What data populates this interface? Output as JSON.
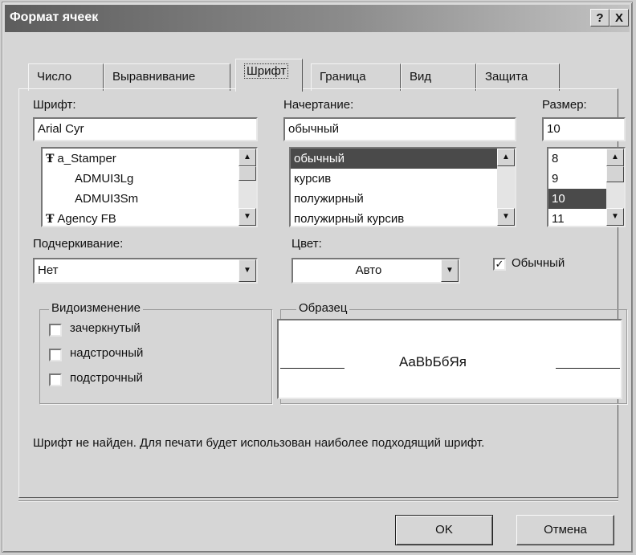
{
  "window": {
    "title": "Формат ячеек",
    "help_button": "?",
    "close_button": "X"
  },
  "tabs": [
    {
      "label": "Число",
      "active": false
    },
    {
      "label": "Выравнивание",
      "active": false
    },
    {
      "label": "Шрифт",
      "active": true
    },
    {
      "label": "Граница",
      "active": false
    },
    {
      "label": "Вид",
      "active": false
    },
    {
      "label": "Защита",
      "active": false
    }
  ],
  "font": {
    "label": "Шрифт:",
    "value": "Arial Cyr",
    "items": [
      {
        "label": "a_Stamper",
        "icon": "truetype-icon"
      },
      {
        "label": "ADMUI3Lg",
        "icon": ""
      },
      {
        "label": "ADMUI3Sm",
        "icon": ""
      },
      {
        "label": "Agency FB",
        "icon": "truetype-icon"
      }
    ]
  },
  "style": {
    "label": "Начертание:",
    "value": "обычный",
    "items": [
      "обычный",
      "курсив",
      "полужирный",
      "полужирный курсив"
    ],
    "selected_index": 0
  },
  "size": {
    "label": "Размер:",
    "value": "10",
    "items": [
      "8",
      "9",
      "10",
      "11"
    ],
    "selected_index": 2
  },
  "underline": {
    "label": "Подчеркивание:",
    "value": "Нет"
  },
  "color": {
    "label": "Цвет:",
    "value": "Авто"
  },
  "normal_checkbox": {
    "label": "Обычный",
    "checked": true
  },
  "effects": {
    "title": "Видоизменение",
    "items": [
      {
        "label": "зачеркнутый",
        "checked": false
      },
      {
        "label": "надстрочный",
        "checked": false
      },
      {
        "label": "подстрочный",
        "checked": false
      }
    ]
  },
  "preview": {
    "title": "Образец",
    "text": "AaBbБбЯя"
  },
  "message": "Шрифт не найден. Для печати будет использован наиболее подходящий шрифт.",
  "buttons": {
    "ok": "OK",
    "cancel": "Отмена"
  }
}
